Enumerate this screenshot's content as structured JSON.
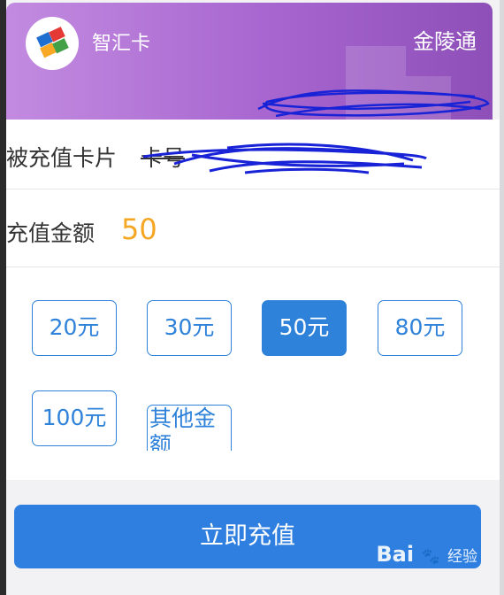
{
  "card": {
    "name": "智汇卡",
    "brand": "金陵通",
    "logo": "zhihui-logo-icon"
  },
  "form": {
    "card_label": "被充值卡片",
    "card_number_label": "卡号",
    "amount_label": "充值金额",
    "amount_value": "50"
  },
  "options": [
    {
      "label": "20元",
      "selected": false
    },
    {
      "label": "30元",
      "selected": false
    },
    {
      "label": "50元",
      "selected": true
    },
    {
      "label": "80元",
      "selected": false
    },
    {
      "label": "100元",
      "selected": false
    }
  ],
  "other_option": "其他金额",
  "actions": {
    "recharge_label": "立即充值"
  },
  "watermark": {
    "brand": "Bai",
    "suffix": "经验"
  },
  "colors": {
    "card_gradient_start": "#c28be0",
    "card_gradient_end": "#8e4fb8",
    "accent_blue": "#2f82d9",
    "amount_orange": "#f5a623"
  }
}
